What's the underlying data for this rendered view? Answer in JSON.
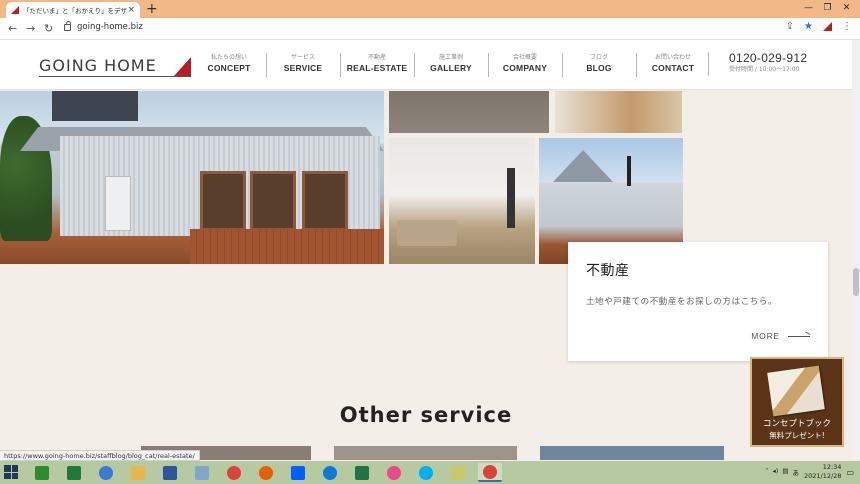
{
  "browser": {
    "tab_title": "「ただいま」と「おかえり」をデザインする",
    "tab_close": "×",
    "new_tab": "+",
    "window_buttons": [
      "—",
      "❐",
      "✕"
    ],
    "url": "going-home.biz",
    "status_url": "https://www.going-home.biz/staffblog/blog_cat/real-estate/"
  },
  "header": {
    "logo": "GOING HOME",
    "nav": [
      {
        "sub": "私たちの想い",
        "main": "CONCEPT"
      },
      {
        "sub": "サービス",
        "main": "SERVICE"
      },
      {
        "sub": "不動産",
        "main": "REAL-ESTATE"
      },
      {
        "sub": "施工事例",
        "main": "GALLERY"
      },
      {
        "sub": "会社概要",
        "main": "COMPANY"
      },
      {
        "sub": "ブログ",
        "main": "BLOG"
      },
      {
        "sub": "お問い合わせ",
        "main": "CONTACT"
      }
    ],
    "phone": "0120-029-912",
    "hours": "受付時間 / 10:00〜17:00"
  },
  "card": {
    "title": "不動産",
    "description": "土地や戸建ての不動産をお探しの方はこちら。",
    "more": "MORE"
  },
  "section": {
    "title": "Other service"
  },
  "banner": {
    "title": "コンセプトブック",
    "subtitle": "無料プレゼント!"
  },
  "taskbar": {
    "time": "12:34",
    "date": "2021/12/28",
    "apps": [
      {
        "name": "store",
        "color": "#2e8b2e"
      },
      {
        "name": "excel-green",
        "color": "#1f7a3a"
      },
      {
        "name": "info",
        "color": "#3a7bd5"
      },
      {
        "name": "explorer",
        "color": "#e6b84a"
      },
      {
        "name": "word",
        "color": "#2b579a"
      },
      {
        "name": "photos",
        "color": "#7fa7c9"
      },
      {
        "name": "chrome",
        "color": "#db4437"
      },
      {
        "name": "firefox",
        "color": "#e66000"
      },
      {
        "name": "dropbox",
        "color": "#0061fe"
      },
      {
        "name": "edge",
        "color": "#0a7bd8"
      },
      {
        "name": "excel",
        "color": "#217346"
      },
      {
        "name": "itunes",
        "color": "#e84a8a"
      },
      {
        "name": "skype",
        "color": "#00aff0"
      },
      {
        "name": "notes",
        "color": "#c9c96a"
      },
      {
        "name": "chrome-active",
        "color": "#db4437"
      }
    ]
  },
  "colors": {
    "accent": "#b51f1f",
    "page_bg": "#f3efe8",
    "tab_strip": "#f2b888",
    "taskbar": "#b7c9a0"
  }
}
